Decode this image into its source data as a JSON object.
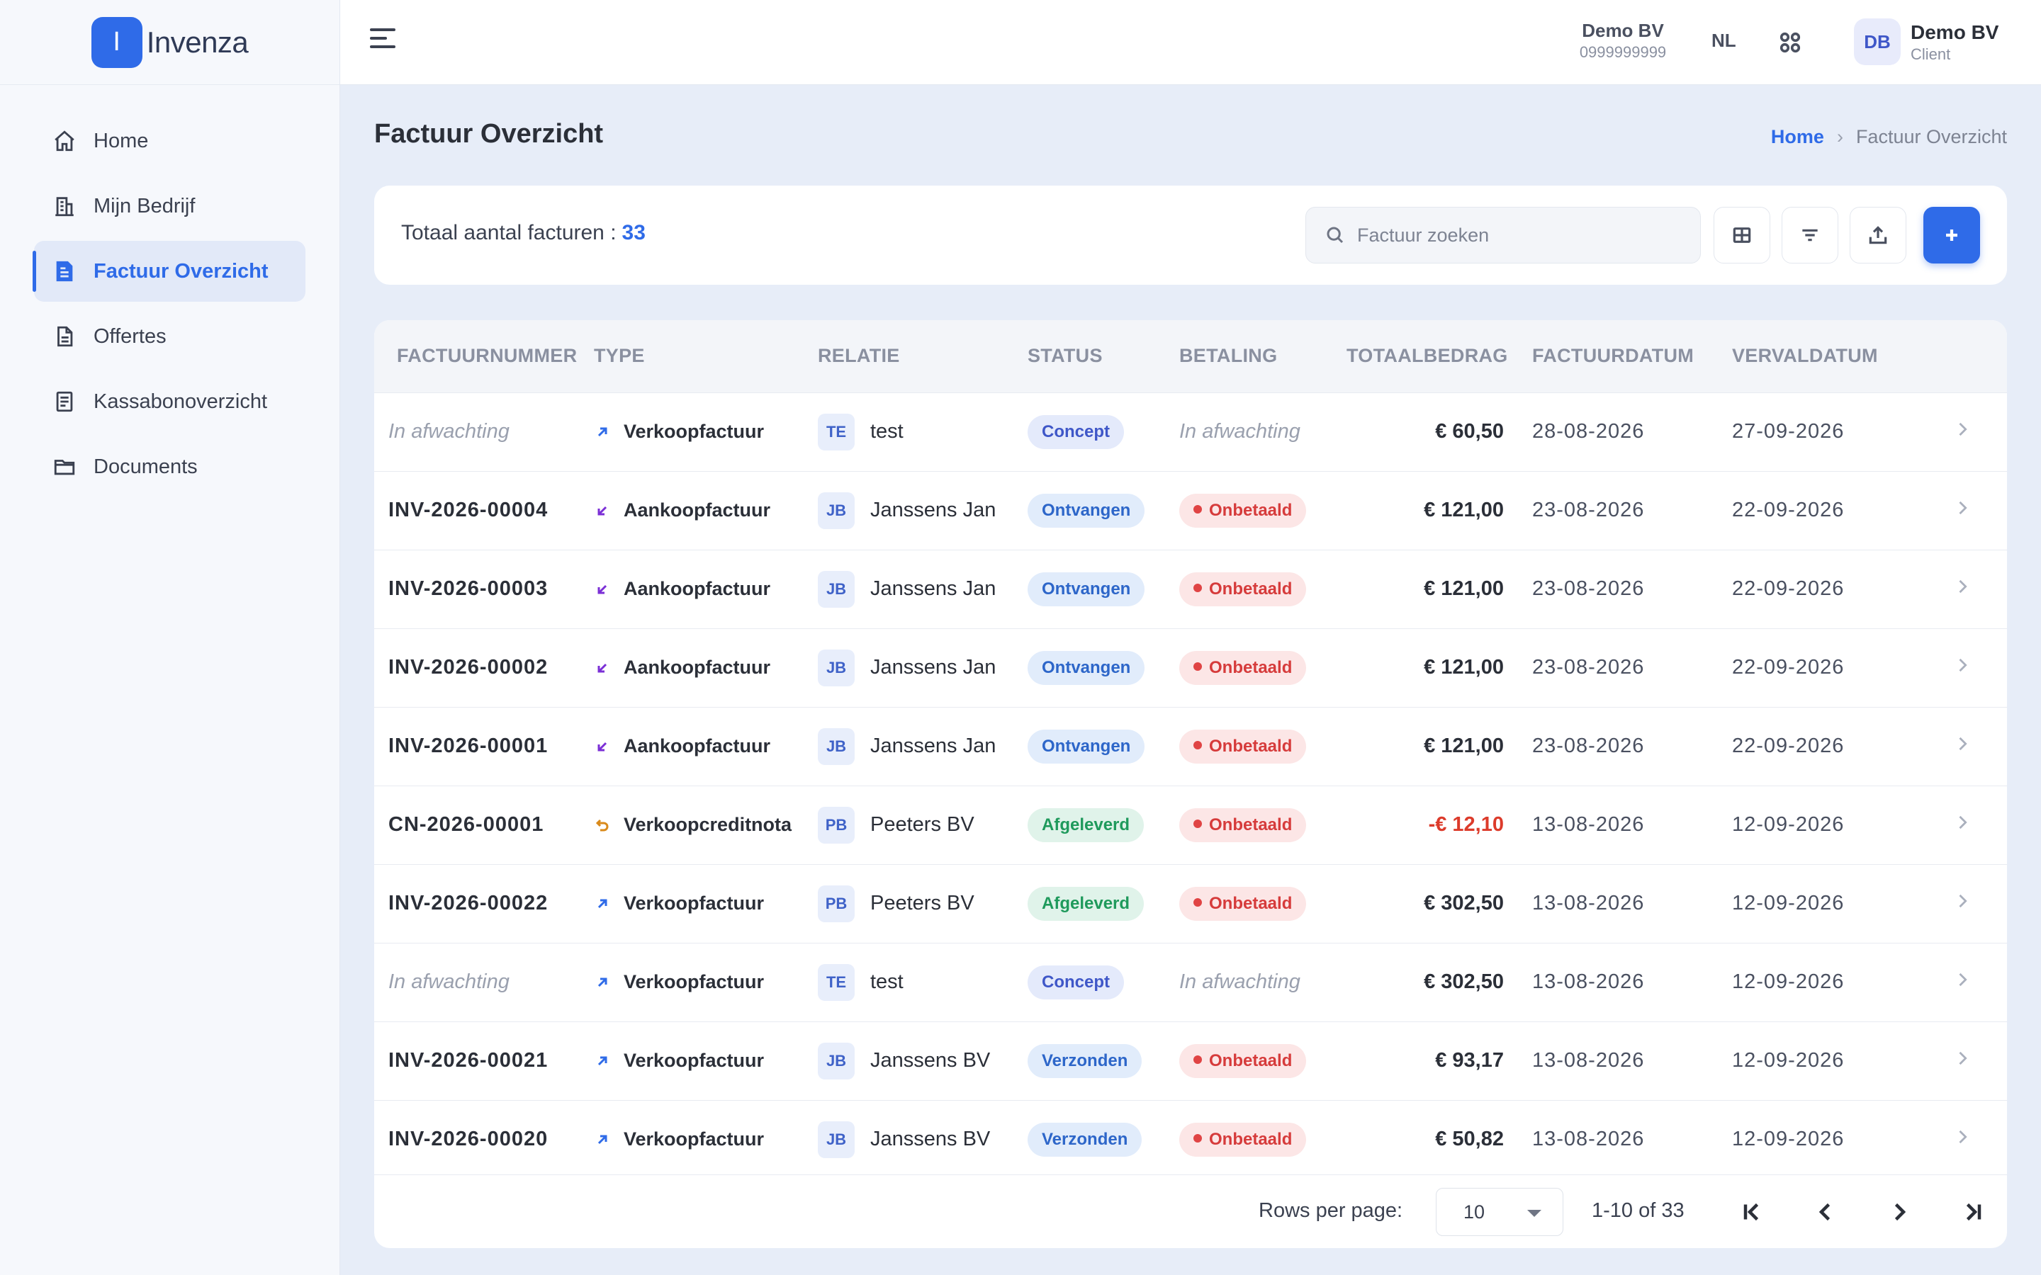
{
  "brand": {
    "logo_letter": "I",
    "name": "Invenza"
  },
  "sidebar": {
    "items": [
      {
        "label": "Home",
        "icon": "home-icon",
        "active": false
      },
      {
        "label": "Mijn Bedrijf",
        "icon": "building-icon",
        "active": false
      },
      {
        "label": "Factuur Overzicht",
        "icon": "invoice-icon",
        "active": true
      },
      {
        "label": "Offertes",
        "icon": "document-icon",
        "active": false
      },
      {
        "label": "Kassabonoverzicht",
        "icon": "receipt-icon",
        "active": false
      },
      {
        "label": "Documents",
        "icon": "folder-icon",
        "active": false
      }
    ]
  },
  "topbar": {
    "company_name": "Demo BV",
    "company_number": "0999999999",
    "language": "NL",
    "avatar_initials": "DB",
    "user_name": "Demo BV",
    "user_role": "Client"
  },
  "page": {
    "title": "Factuur Overzicht",
    "breadcrumb": {
      "home": "Home",
      "current": "Factuur Overzicht"
    }
  },
  "toolbar": {
    "total_label": "Totaal aantal facturen :",
    "total_count": "33",
    "search_placeholder": "Factuur zoeken"
  },
  "table": {
    "columns": [
      "FACTUURNUMMER",
      "TYPE",
      "RELATIE",
      "STATUS",
      "BETALING",
      "TOTAALBEDRAG",
      "FACTUURDATUM",
      "VERVALDATUM"
    ],
    "rows": [
      {
        "number": "In afwachting",
        "pending": true,
        "type": "Verkoopfactuur",
        "type_kind": "out",
        "rel_initials": "TE",
        "relation": "test",
        "status": "Concept",
        "status_kind": "concept",
        "payment": "In afwachting",
        "payment_kind": "pending",
        "amount": "€ 60,50",
        "negative": false,
        "invoice_date": "28-08-2026",
        "due_date": "27-09-2026"
      },
      {
        "number": "INV-2026-00004",
        "pending": false,
        "type": "Aankoopfactuur",
        "type_kind": "in",
        "rel_initials": "JB",
        "relation": "Janssens Jan",
        "status": "Ontvangen",
        "status_kind": "info",
        "payment": "Onbetaald",
        "payment_kind": "unpaid",
        "amount": "€ 121,00",
        "negative": false,
        "invoice_date": "23-08-2026",
        "due_date": "22-09-2026"
      },
      {
        "number": "INV-2026-00003",
        "pending": false,
        "type": "Aankoopfactuur",
        "type_kind": "in",
        "rel_initials": "JB",
        "relation": "Janssens Jan",
        "status": "Ontvangen",
        "status_kind": "info",
        "payment": "Onbetaald",
        "payment_kind": "unpaid",
        "amount": "€ 121,00",
        "negative": false,
        "invoice_date": "23-08-2026",
        "due_date": "22-09-2026"
      },
      {
        "number": "INV-2026-00002",
        "pending": false,
        "type": "Aankoopfactuur",
        "type_kind": "in",
        "rel_initials": "JB",
        "relation": "Janssens Jan",
        "status": "Ontvangen",
        "status_kind": "info",
        "payment": "Onbetaald",
        "payment_kind": "unpaid",
        "amount": "€ 121,00",
        "negative": false,
        "invoice_date": "23-08-2026",
        "due_date": "22-09-2026"
      },
      {
        "number": "INV-2026-00001",
        "pending": false,
        "type": "Aankoopfactuur",
        "type_kind": "in",
        "rel_initials": "JB",
        "relation": "Janssens Jan",
        "status": "Ontvangen",
        "status_kind": "info",
        "payment": "Onbetaald",
        "payment_kind": "unpaid",
        "amount": "€ 121,00",
        "negative": false,
        "invoice_date": "23-08-2026",
        "due_date": "22-09-2026"
      },
      {
        "number": "CN-2026-00001",
        "pending": false,
        "type": "Verkoopcreditnota",
        "type_kind": "credit",
        "rel_initials": "PB",
        "relation": "Peeters BV",
        "status": "Afgeleverd",
        "status_kind": "success",
        "payment": "Onbetaald",
        "payment_kind": "unpaid",
        "amount": "-€ 12,10",
        "negative": true,
        "invoice_date": "13-08-2026",
        "due_date": "12-09-2026"
      },
      {
        "number": "INV-2026-00022",
        "pending": false,
        "type": "Verkoopfactuur",
        "type_kind": "out",
        "rel_initials": "PB",
        "relation": "Peeters BV",
        "status": "Afgeleverd",
        "status_kind": "success",
        "payment": "Onbetaald",
        "payment_kind": "unpaid",
        "amount": "€ 302,50",
        "negative": false,
        "invoice_date": "13-08-2026",
        "due_date": "12-09-2026"
      },
      {
        "number": "In afwachting",
        "pending": true,
        "type": "Verkoopfactuur",
        "type_kind": "out",
        "rel_initials": "TE",
        "relation": "test",
        "status": "Concept",
        "status_kind": "concept",
        "payment": "In afwachting",
        "payment_kind": "pending",
        "amount": "€ 302,50",
        "negative": false,
        "invoice_date": "13-08-2026",
        "due_date": "12-09-2026"
      },
      {
        "number": "INV-2026-00021",
        "pending": false,
        "type": "Verkoopfactuur",
        "type_kind": "out",
        "rel_initials": "JB",
        "relation": "Janssens BV",
        "status": "Verzonden",
        "status_kind": "info",
        "payment": "Onbetaald",
        "payment_kind": "unpaid",
        "amount": "€ 93,17",
        "negative": false,
        "invoice_date": "13-08-2026",
        "due_date": "12-09-2026"
      },
      {
        "number": "INV-2026-00020",
        "pending": false,
        "type": "Verkoopfactuur",
        "type_kind": "out",
        "rel_initials": "JB",
        "relation": "Janssens BV",
        "status": "Verzonden",
        "status_kind": "info",
        "payment": "Onbetaald",
        "payment_kind": "unpaid",
        "amount": "€ 50,82",
        "negative": false,
        "invoice_date": "13-08-2026",
        "due_date": "12-09-2026"
      }
    ]
  },
  "pagination": {
    "rows_per_page_label": "Rows per page:",
    "rows_per_page_value": "10",
    "range": "1-10 of 33"
  },
  "colors": {
    "primary": "#2F6BE8",
    "sidebar_bg": "#F6F8FC",
    "content_bg": "#E7EDF8",
    "concept_badge": "#E4EAFB",
    "info_badge": "#E1ECFB",
    "success_badge": "#E0F3EA",
    "unpaid_badge": "#FCE6E6",
    "negative_amount": "#DC3B2B",
    "in_arrow": "#7B2FD6",
    "credit_icon": "#D98A1B"
  }
}
